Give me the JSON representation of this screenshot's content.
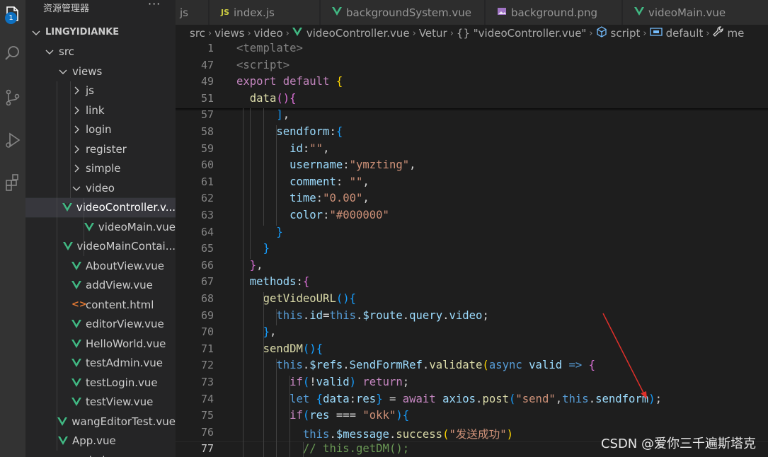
{
  "activity_bar": {
    "badge_count": "1",
    "icons": [
      "files-icon",
      "search-icon",
      "source-control-icon",
      "run-debug-icon",
      "extensions-icon"
    ]
  },
  "sidebar": {
    "title": "资源管理器",
    "more": "···",
    "tree": [
      {
        "label": "LINGYIDIANKE",
        "kind": "folder-open",
        "depth": 0,
        "bold": true
      },
      {
        "label": "src",
        "kind": "folder-open",
        "depth": 1
      },
      {
        "label": "views",
        "kind": "folder-open",
        "depth": 2
      },
      {
        "label": "js",
        "kind": "folder",
        "depth": 3
      },
      {
        "label": "link",
        "kind": "folder",
        "depth": 3
      },
      {
        "label": "login",
        "kind": "folder",
        "depth": 3
      },
      {
        "label": "register",
        "kind": "folder",
        "depth": 3
      },
      {
        "label": "simple",
        "kind": "folder",
        "depth": 3
      },
      {
        "label": "video",
        "kind": "folder-open",
        "depth": 3
      },
      {
        "label": "videoController.v...",
        "kind": "vue",
        "depth": 4,
        "selected": true
      },
      {
        "label": "videoMain.vue",
        "kind": "vue",
        "depth": 4
      },
      {
        "label": "videoMainContai...",
        "kind": "vue",
        "depth": 4
      },
      {
        "label": "AboutView.vue",
        "kind": "vue",
        "depth": 3
      },
      {
        "label": "addView.vue",
        "kind": "vue",
        "depth": 3
      },
      {
        "label": "content.html",
        "kind": "html",
        "depth": 3
      },
      {
        "label": "editorView.vue",
        "kind": "vue",
        "depth": 3
      },
      {
        "label": "HelloWorld.vue",
        "kind": "vue",
        "depth": 3
      },
      {
        "label": "testAdmin.vue",
        "kind": "vue",
        "depth": 3
      },
      {
        "label": "testLogin.vue",
        "kind": "vue",
        "depth": 3
      },
      {
        "label": "testView.vue",
        "kind": "vue",
        "depth": 3
      },
      {
        "label": "wangEditorTest.vue",
        "kind": "vue",
        "depth": 3
      },
      {
        "label": "App.vue",
        "kind": "vue",
        "depth": 2
      },
      {
        "label": "main.js",
        "kind": "js",
        "depth": 2
      }
    ]
  },
  "tabs": [
    {
      "label": "js",
      "icon": "none"
    },
    {
      "label": "index.js",
      "icon": "js-file-icon"
    },
    {
      "label": "backgroundSystem.vue",
      "icon": "vue-file-icon"
    },
    {
      "label": "background.png",
      "icon": "image-file-icon"
    },
    {
      "label": "videoMain.vue",
      "icon": "vue-file-icon"
    }
  ],
  "breadcrumb": {
    "items": [
      "src",
      "views",
      "video",
      "videoController.vue",
      "Vetur",
      "{} \"videoController.vue\"",
      "script",
      "default",
      "me"
    ]
  },
  "editor": {
    "current_line": "77",
    "lines": [
      {
        "n": "1",
        "tokens": [
          [
            "<template>",
            "#808080"
          ]
        ]
      },
      {
        "n": "47",
        "tokens": [
          [
            "<script>",
            "#808080"
          ]
        ]
      },
      {
        "n": "49",
        "tokens": [
          [
            "export ",
            "#c586c0"
          ],
          [
            "default ",
            "#c586c0"
          ],
          [
            "{",
            "#ffd700"
          ]
        ]
      },
      {
        "n": "51",
        "tokens": [
          [
            "  ",
            "#d4d4d4"
          ],
          [
            "data",
            "#dcdcaa"
          ],
          [
            "()",
            "#da70d6"
          ],
          [
            "{",
            "#da70d6"
          ]
        ]
      },
      {
        "n": "57",
        "tokens": [
          [
            "      ",
            "#d4d4d4"
          ],
          [
            "]",
            "#179fff"
          ],
          [
            ",",
            "#d4d4d4"
          ]
        ]
      },
      {
        "n": "58",
        "tokens": [
          [
            "      ",
            "#d4d4d4"
          ],
          [
            "sendform",
            "#9cdcfe"
          ],
          [
            ":",
            "#d4d4d4"
          ],
          [
            "{",
            "#179fff"
          ]
        ]
      },
      {
        "n": "59",
        "tokens": [
          [
            "        ",
            "#d4d4d4"
          ],
          [
            "id",
            "#9cdcfe"
          ],
          [
            ":",
            "#d4d4d4"
          ],
          [
            "\"\"",
            "#ce9178"
          ],
          [
            ",",
            "#d4d4d4"
          ]
        ]
      },
      {
        "n": "60",
        "tokens": [
          [
            "        ",
            "#d4d4d4"
          ],
          [
            "username",
            "#9cdcfe"
          ],
          [
            ":",
            "#d4d4d4"
          ],
          [
            "\"ymzting\"",
            "#ce9178"
          ],
          [
            ",",
            "#d4d4d4"
          ]
        ]
      },
      {
        "n": "61",
        "tokens": [
          [
            "        ",
            "#d4d4d4"
          ],
          [
            "comment",
            "#9cdcfe"
          ],
          [
            ": ",
            "#d4d4d4"
          ],
          [
            "\"\"",
            "#ce9178"
          ],
          [
            ",",
            "#d4d4d4"
          ]
        ]
      },
      {
        "n": "62",
        "tokens": [
          [
            "        ",
            "#d4d4d4"
          ],
          [
            "time",
            "#9cdcfe"
          ],
          [
            ":",
            "#d4d4d4"
          ],
          [
            "\"0.00\"",
            "#ce9178"
          ],
          [
            ",",
            "#d4d4d4"
          ]
        ]
      },
      {
        "n": "63",
        "tokens": [
          [
            "        ",
            "#d4d4d4"
          ],
          [
            "color",
            "#9cdcfe"
          ],
          [
            ":",
            "#d4d4d4"
          ],
          [
            "\"#000000\"",
            "#ce9178"
          ]
        ]
      },
      {
        "n": "64",
        "tokens": [
          [
            "      ",
            "#d4d4d4"
          ],
          [
            "}",
            "#179fff"
          ]
        ]
      },
      {
        "n": "65",
        "tokens": [
          [
            "    ",
            "#d4d4d4"
          ],
          [
            "}",
            "#179fff"
          ]
        ]
      },
      {
        "n": "66",
        "tokens": [
          [
            "  ",
            "#d4d4d4"
          ],
          [
            "}",
            "#da70d6"
          ],
          [
            ",",
            "#d4d4d4"
          ]
        ]
      },
      {
        "n": "67",
        "tokens": [
          [
            "  ",
            "#d4d4d4"
          ],
          [
            "methods",
            "#9cdcfe"
          ],
          [
            ":",
            "#d4d4d4"
          ],
          [
            "{",
            "#da70d6"
          ]
        ]
      },
      {
        "n": "68",
        "tokens": [
          [
            "    ",
            "#d4d4d4"
          ],
          [
            "getVideoURL",
            "#dcdcaa"
          ],
          [
            "()",
            "#179fff"
          ],
          [
            "{",
            "#179fff"
          ]
        ]
      },
      {
        "n": "69",
        "tokens": [
          [
            "      ",
            "#d4d4d4"
          ],
          [
            "this",
            "#569cd6"
          ],
          [
            ".",
            "#d4d4d4"
          ],
          [
            "id",
            "#9cdcfe"
          ],
          [
            "=",
            "#d4d4d4"
          ],
          [
            "this",
            "#569cd6"
          ],
          [
            ".",
            "#d4d4d4"
          ],
          [
            "$route",
            "#9cdcfe"
          ],
          [
            ".",
            "#d4d4d4"
          ],
          [
            "query",
            "#9cdcfe"
          ],
          [
            ".",
            "#d4d4d4"
          ],
          [
            "video",
            "#9cdcfe"
          ],
          [
            ";",
            "#d4d4d4"
          ]
        ]
      },
      {
        "n": "70",
        "tokens": [
          [
            "    ",
            "#d4d4d4"
          ],
          [
            "}",
            "#179fff"
          ],
          [
            ",",
            "#d4d4d4"
          ]
        ]
      },
      {
        "n": "71",
        "tokens": [
          [
            "    ",
            "#d4d4d4"
          ],
          [
            "sendDM",
            "#dcdcaa"
          ],
          [
            "()",
            "#179fff"
          ],
          [
            "{",
            "#179fff"
          ]
        ]
      },
      {
        "n": "72",
        "tokens": [
          [
            "      ",
            "#d4d4d4"
          ],
          [
            "this",
            "#569cd6"
          ],
          [
            ".",
            "#d4d4d4"
          ],
          [
            "$refs",
            "#9cdcfe"
          ],
          [
            ".",
            "#d4d4d4"
          ],
          [
            "SendFormRef",
            "#9cdcfe"
          ],
          [
            ".",
            "#d4d4d4"
          ],
          [
            "validate",
            "#dcdcaa"
          ],
          [
            "(",
            "#ffd700"
          ],
          [
            "async ",
            "#569cd6"
          ],
          [
            "valid ",
            "#9cdcfe"
          ],
          [
            "=> ",
            "#569cd6"
          ],
          [
            "{",
            "#da70d6"
          ]
        ]
      },
      {
        "n": "73",
        "tokens": [
          [
            "        ",
            "#d4d4d4"
          ],
          [
            "if",
            "#c586c0"
          ],
          [
            "(",
            "#179fff"
          ],
          [
            "!",
            "#d4d4d4"
          ],
          [
            "valid",
            "#9cdcfe"
          ],
          [
            ") ",
            "#179fff"
          ],
          [
            "return",
            "#c586c0"
          ],
          [
            ";",
            "#d4d4d4"
          ]
        ]
      },
      {
        "n": "74",
        "tokens": [
          [
            "        ",
            "#d4d4d4"
          ],
          [
            "let ",
            "#569cd6"
          ],
          [
            "{",
            "#179fff"
          ],
          [
            "data",
            "#9cdcfe"
          ],
          [
            ":",
            "#d4d4d4"
          ],
          [
            "res",
            "#9cdcfe"
          ],
          [
            "} ",
            "#179fff"
          ],
          [
            "= ",
            "#d4d4d4"
          ],
          [
            "await ",
            "#c586c0"
          ],
          [
            "axios",
            "#9cdcfe"
          ],
          [
            ".",
            "#d4d4d4"
          ],
          [
            "post",
            "#dcdcaa"
          ],
          [
            "(",
            "#179fff"
          ],
          [
            "\"send\"",
            "#ce9178"
          ],
          [
            ",",
            "#d4d4d4"
          ],
          [
            "this",
            "#569cd6"
          ],
          [
            ".",
            "#d4d4d4"
          ],
          [
            "sendform",
            "#9cdcfe"
          ],
          [
            ")",
            "#179fff"
          ],
          [
            ";",
            "#d4d4d4"
          ]
        ]
      },
      {
        "n": "75",
        "tokens": [
          [
            "        ",
            "#d4d4d4"
          ],
          [
            "if",
            "#c586c0"
          ],
          [
            "(",
            "#179fff"
          ],
          [
            "res ",
            "#9cdcfe"
          ],
          [
            "=== ",
            "#d4d4d4"
          ],
          [
            "\"okk\"",
            "#ce9178"
          ],
          [
            ")",
            "#179fff"
          ],
          [
            "{",
            "#179fff"
          ]
        ]
      },
      {
        "n": "76",
        "tokens": [
          [
            "          ",
            "#d4d4d4"
          ],
          [
            "this",
            "#569cd6"
          ],
          [
            ".",
            "#d4d4d4"
          ],
          [
            "$message",
            "#9cdcfe"
          ],
          [
            ".",
            "#d4d4d4"
          ],
          [
            "success",
            "#dcdcaa"
          ],
          [
            "(",
            "#ffd700"
          ],
          [
            "\"发送成功\"",
            "#ce9178"
          ],
          [
            ")",
            "#ffd700"
          ]
        ]
      },
      {
        "n": "77",
        "tokens": [
          [
            "          ",
            "#d4d4d4"
          ],
          [
            "// this.getDM();",
            "#6a9955"
          ]
        ]
      }
    ]
  },
  "watermark": "CSDN @爱你三千遍斯塔克",
  "colors": {
    "annotation_arrow": "#e0302a",
    "vue_icon": "#41b883",
    "selection": "#37373d"
  }
}
